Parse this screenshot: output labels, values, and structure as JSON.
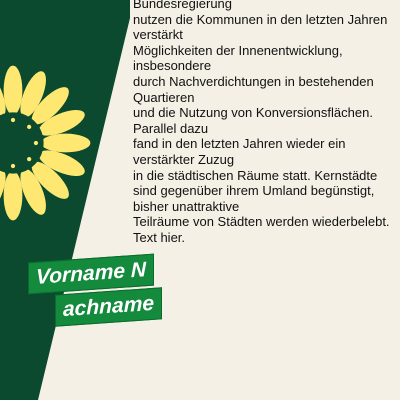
{
  "body_lines": [
    "Bundesregierung",
    "nutzen die Kommunen in den letzten Jahren",
    "verstärkt",
    "Möglichkeiten der Innenentwicklung,",
    "insbesondere",
    "durch Nachverdichtungen in bestehenden",
    "Quartieren",
    "und die Nutzung von Konversionsflächen.",
    "Parallel dazu",
    "fand in den letzten Jahren wieder ein",
    "verstärkter Zuzug",
    "in die städtischen Räume statt. Kernstädte",
    "sind gegenüber ihrem Umland begünstigt,",
    "bisher unattraktive",
    "Teilräume von Städten werden wiederbelebt.",
    "Text hier."
  ],
  "name_tag": {
    "first": "Vorname N",
    "second": "achname"
  },
  "colors": {
    "background": "#f5f0e6",
    "dark_green": "#0b4a2e",
    "tag_green": "#138a3c",
    "sunflower": "#ffe872",
    "text": "#111111"
  },
  "icons": {
    "logo": "sunflower-icon"
  }
}
